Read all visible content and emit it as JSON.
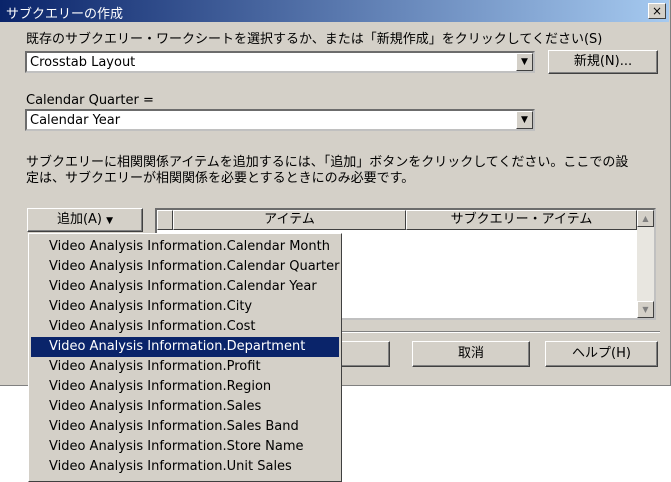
{
  "window": {
    "title": "サブクエリーの作成",
    "close_glyph": "×"
  },
  "prompt_label": "既存のサブクエリー・ワークシートを選択するか、または「新規作成」をクリックしてください(S)",
  "worksheet_combo": {
    "value": "Crosstab Layout"
  },
  "new_button": "新規(N)...",
  "condition_label": "Calendar Quarter =",
  "condition_combo": {
    "value": "Calendar Year"
  },
  "info_text_line1": "サブクエリーに相関関係アイテムを追加するには、「追加」ボタンをクリックしてください。ここでの設",
  "info_text_line2": "定は、サブクエリーが相関関係を必要とするときにのみ必要です。",
  "add_button": "追加(A)",
  "grid": {
    "col_item": "アイテム",
    "col_subquery_item": "サブクエリー・アイテム"
  },
  "cancel_button": "取消",
  "help_button": "ヘルプ(H)",
  "dropdown_menu": {
    "items": [
      "Video Analysis Information.Calendar Month",
      "Video Analysis Information.Calendar Quarter",
      "Video Analysis Information.Calendar Year",
      "Video Analysis Information.City",
      "Video Analysis Information.Cost",
      "Video Analysis Information.Department",
      "Video Analysis Information.Profit",
      "Video Analysis Information.Region",
      "Video Analysis Information.Sales",
      "Video Analysis Information.Sales Band",
      "Video Analysis Information.Store Name",
      "Video Analysis Information.Unit Sales"
    ],
    "selected_item": "Video Analysis Information.Department"
  },
  "colors": {
    "title_bar": "#0a246a",
    "selection": "#0a246a",
    "face": "#d4d0c8"
  }
}
